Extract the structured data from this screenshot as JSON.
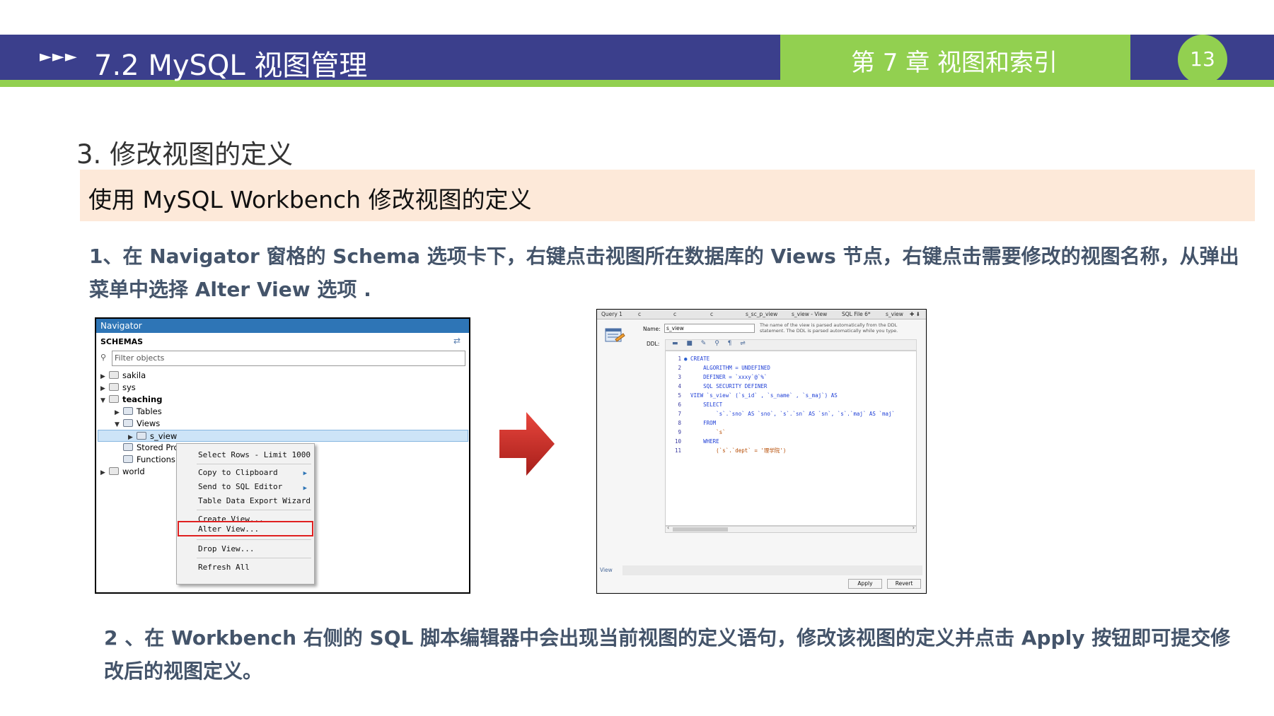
{
  "header": {
    "arrows": "►►►",
    "title": "7.2  MySQL 视图管理",
    "chapter": "第 7 章  视图和索引",
    "page_number": "13"
  },
  "section": {
    "heading": "3.  修改视图的定义",
    "subheading": "使用 MySQL Workbench 修改视图的定义"
  },
  "steps": {
    "step1": "1、在 Navigator 窗格的 Schema 选项卡下，右键点击视图所在数据库的 Views 节点，右键点击需要修改的视图名称，从弹出菜单中选择 Alter View 选项 .",
    "step2": "2 、在 Workbench 右侧的 SQL 脚本编辑器中会出现当前视图的定义语句，修改该视图的定义并点击 Apply 按钮即可提交修改后的视图定义。"
  },
  "navigator": {
    "title": "Navigator",
    "schemas_label": "SCHEMAS",
    "filter_placeholder": "Filter objects",
    "tree": {
      "sakila": "sakila",
      "sys": "sys",
      "teaching": "teaching",
      "tables": "Tables",
      "views": "Views",
      "s_view": "s_view",
      "stored": "Stored Pro",
      "functions": "Functions",
      "world": "world"
    },
    "context_menu": [
      "Select Rows - Limit 1000",
      "Copy to Clipboard",
      "Send to SQL Editor",
      "Table Data Export Wizard",
      "Create View...",
      "Alter View...",
      "Drop View...",
      "Refresh All"
    ],
    "highlighted_item": "Alter View..."
  },
  "workbench": {
    "tabs": [
      "Query 1",
      "c",
      "c",
      "c",
      "s_sc_p_view",
      "s_view - View",
      "SQL File 6*",
      "s_view"
    ],
    "name_label": "Name:",
    "name_value": "s_view",
    "hint": "The name of the view is parsed automatically from the DDL statement. The DDL is parsed automatically while you type.",
    "ddl_label": "DDL:",
    "code": [
      {
        "n": "1",
        "text": "CREATE"
      },
      {
        "n": "2",
        "text": "    ALGORITHM = UNDEFINED"
      },
      {
        "n": "3",
        "text": "    DEFINER = `xxxy`@`%`"
      },
      {
        "n": "4",
        "text": "    SQL SECURITY DEFINER"
      },
      {
        "n": "5",
        "text": "VIEW `s_view` (`s_id` , `s_name` , `s_maj`) AS"
      },
      {
        "n": "6",
        "text": "    SELECT"
      },
      {
        "n": "7",
        "text": "        `s`.`sno` AS `sno`, `s`.`sn` AS `sn`, `s`.`maj` AS `maj`"
      },
      {
        "n": "8",
        "text": "    FROM"
      },
      {
        "n": "9",
        "text": "        `s`"
      },
      {
        "n": "10",
        "text": "    WHERE"
      },
      {
        "n": "11",
        "text": "        (`s`.`dept` = '理学院')"
      }
    ],
    "view_tab": "View",
    "apply_button": "Apply",
    "revert_button": "Revert"
  },
  "colors": {
    "header_blue": "#3b3f8c",
    "accent_green": "#92d050",
    "subheading_bg": "#fde9d9",
    "step_text": "#44546a",
    "arrow_red": "#d9302a"
  },
  "icons": {
    "arrow": "right-arrow-icon",
    "refresh": "refresh-icon",
    "search": "search-icon"
  }
}
